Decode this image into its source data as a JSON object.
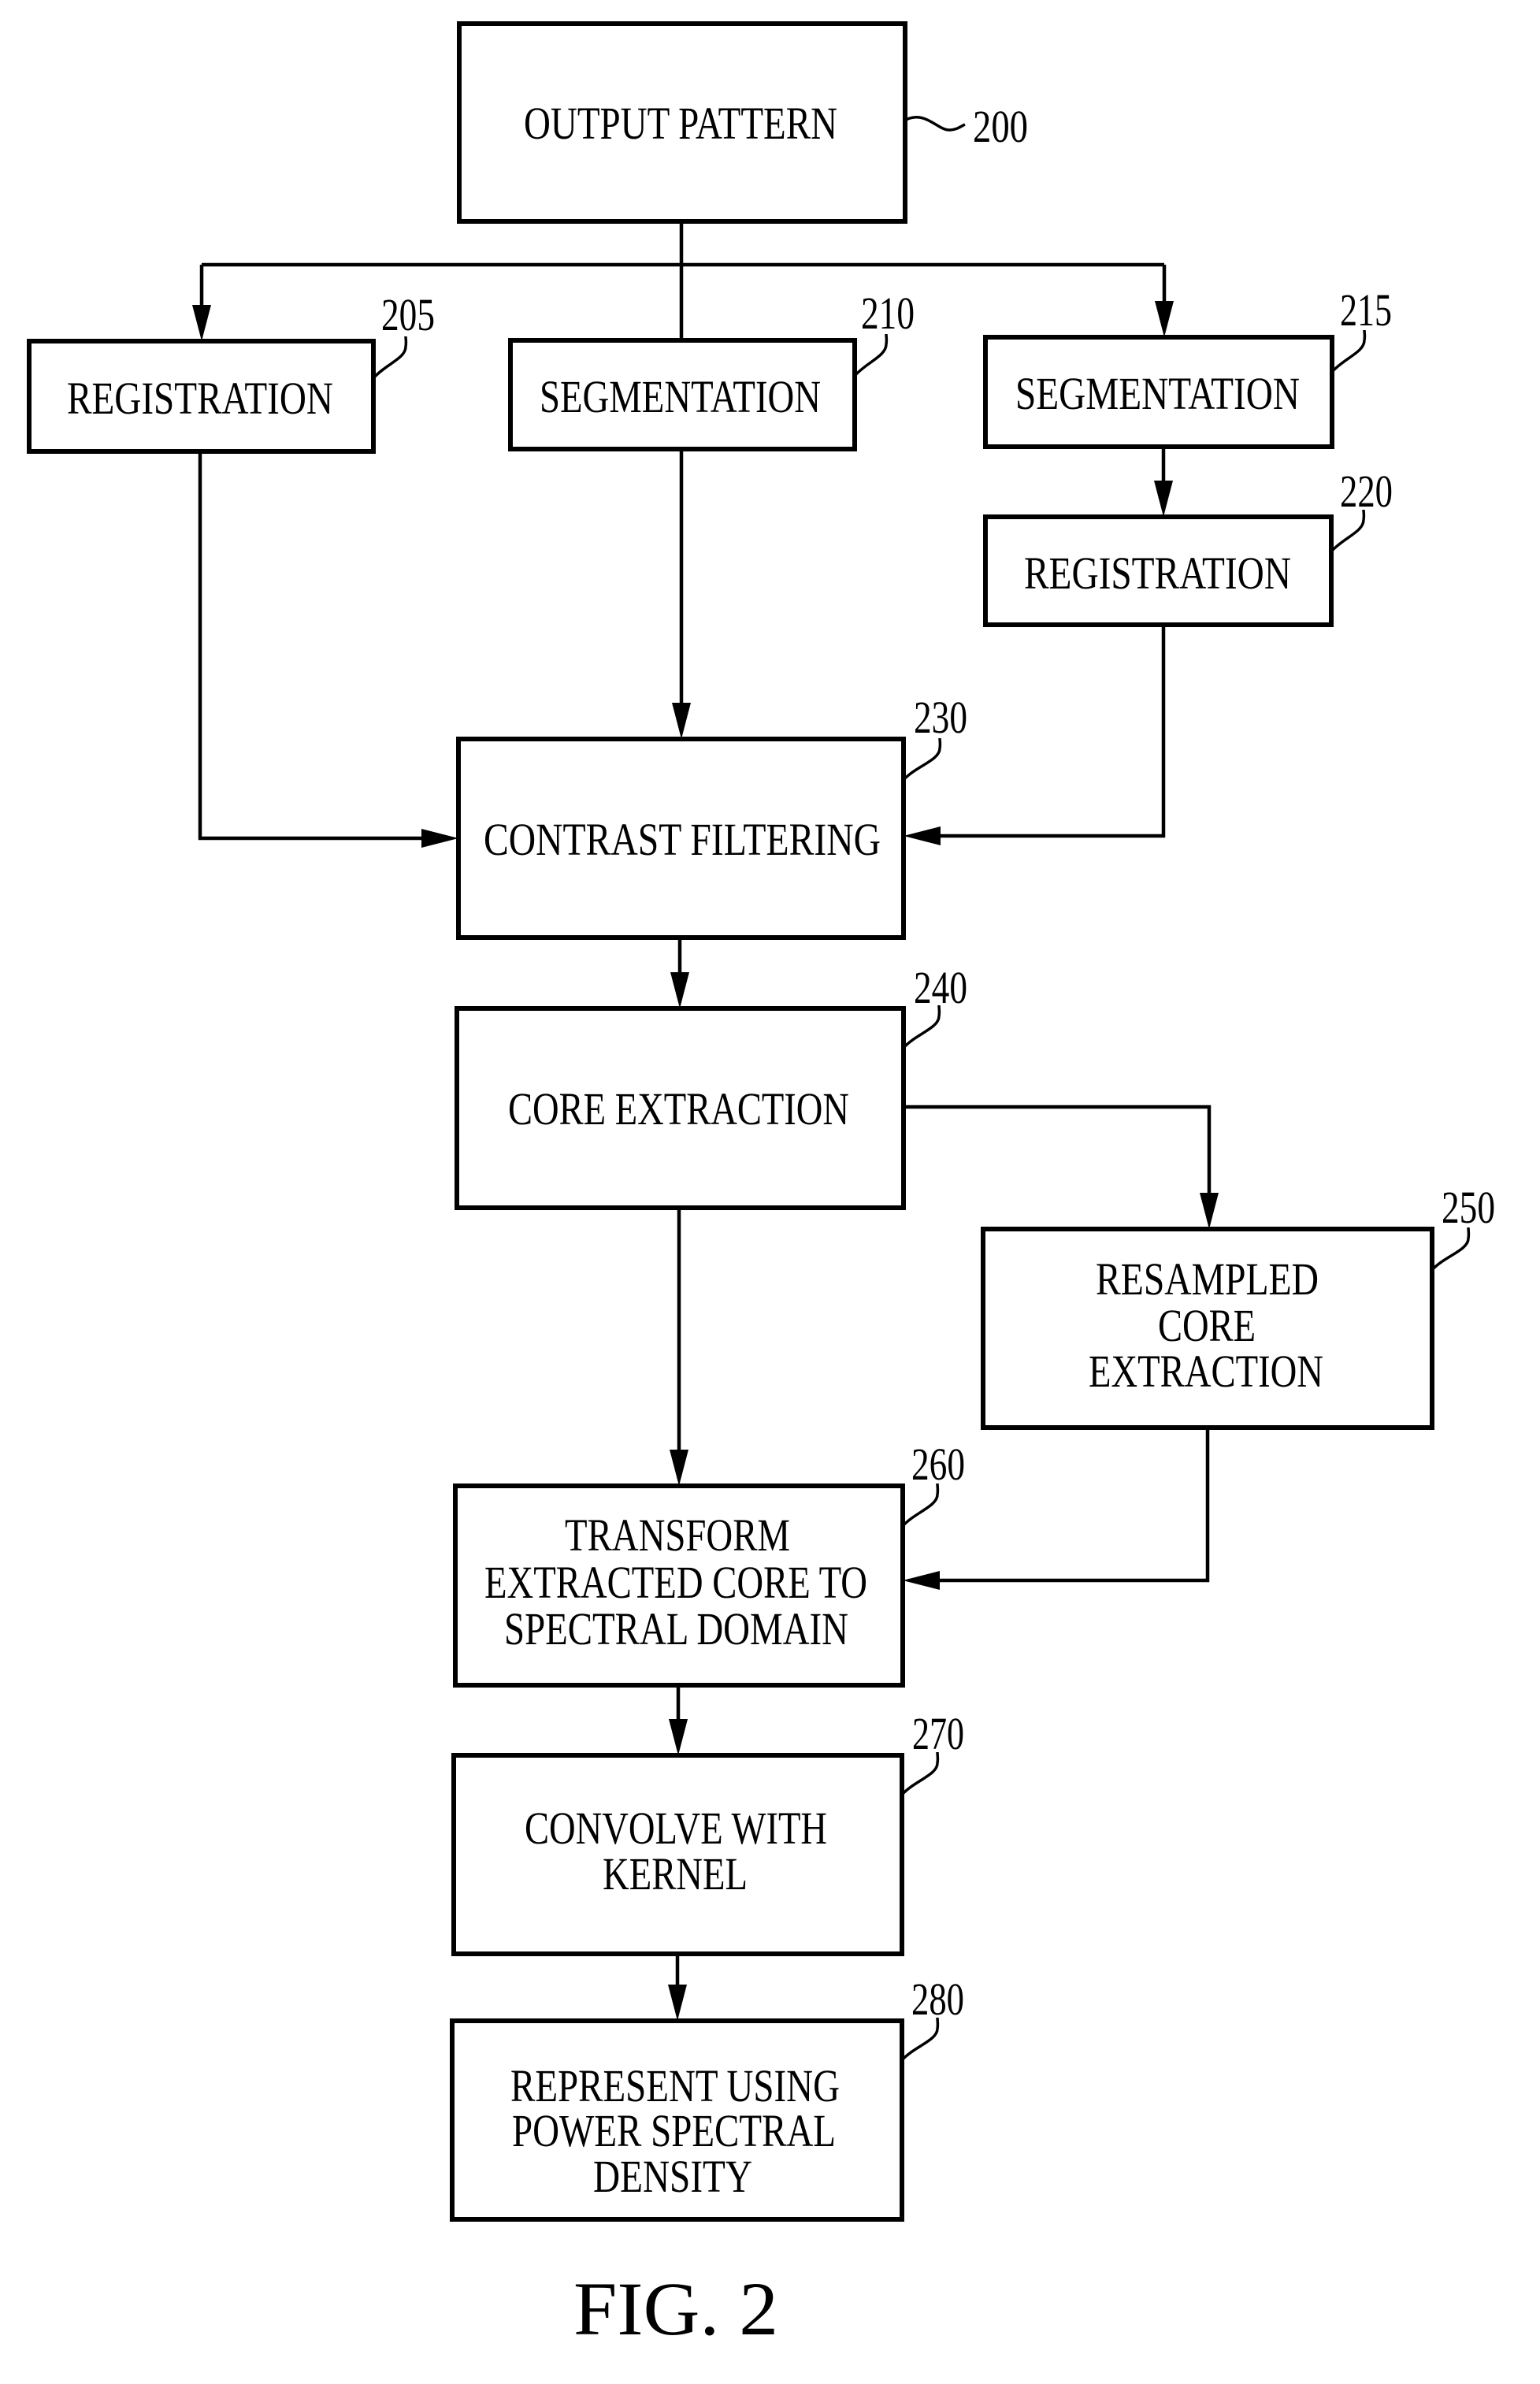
{
  "figure": {
    "caption": "FIG. 2",
    "colors": {
      "ink": "#000000",
      "paper": "#ffffff"
    }
  },
  "nodes": {
    "n200": {
      "ref": "200",
      "lines": [
        "OUTPUT PATTERN"
      ]
    },
    "n205": {
      "ref": "205",
      "lines": [
        "REGISTRATION"
      ]
    },
    "n210": {
      "ref": "210",
      "lines": [
        "SEGMENTATION"
      ]
    },
    "n215": {
      "ref": "215",
      "lines": [
        "SEGMENTATION"
      ]
    },
    "n220": {
      "ref": "220",
      "lines": [
        "REGISTRATION"
      ]
    },
    "n230": {
      "ref": "230",
      "lines": [
        "CONTRAST FILTERING"
      ]
    },
    "n240": {
      "ref": "240",
      "lines": [
        "CORE EXTRACTION"
      ]
    },
    "n250": {
      "ref": "250",
      "lines": [
        "RESAMPLED",
        "CORE",
        "EXTRACTION"
      ]
    },
    "n260": {
      "ref": "260",
      "lines": [
        "TRANSFORM",
        "EXTRACTED CORE TO",
        "SPECTRAL DOMAIN"
      ]
    },
    "n270": {
      "ref": "270",
      "lines": [
        "CONVOLVE WITH",
        "KERNEL"
      ]
    },
    "n280": {
      "ref": "280",
      "lines": [
        "REPRESENT USING",
        "POWER SPECTRAL",
        "DENSITY"
      ]
    }
  },
  "edges": [
    {
      "from": "200",
      "to": "205"
    },
    {
      "from": "200",
      "to": "210"
    },
    {
      "from": "200",
      "to": "215"
    },
    {
      "from": "215",
      "to": "220"
    },
    {
      "from": "205",
      "to": "230"
    },
    {
      "from": "210",
      "to": "230"
    },
    {
      "from": "220",
      "to": "230"
    },
    {
      "from": "230",
      "to": "240"
    },
    {
      "from": "240",
      "to": "250"
    },
    {
      "from": "240",
      "to": "260"
    },
    {
      "from": "250",
      "to": "260"
    },
    {
      "from": "260",
      "to": "270"
    },
    {
      "from": "270",
      "to": "280"
    }
  ]
}
